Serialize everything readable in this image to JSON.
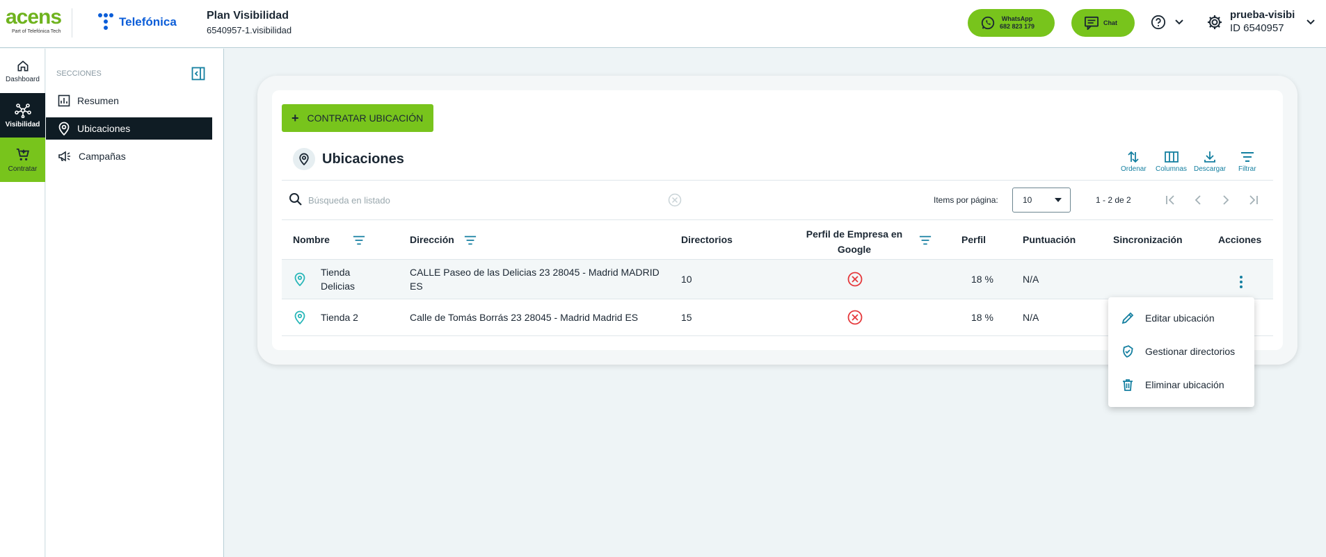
{
  "header": {
    "brand_acens": "acens",
    "brand_acens_sub": "Part of Telefónica Tech",
    "brand_telefonica": "Telefónica",
    "plan_title": "Plan Visibilidad",
    "plan_subtitle": "6540957-1.visibilidad",
    "whatsapp_label": "WhatsApp",
    "whatsapp_number": "682 823 179",
    "chat_label": "Chat",
    "user_name": "prueba-visibi",
    "user_id": "ID 6540957"
  },
  "leftnav": {
    "dashboard": "Dashboard",
    "visibilidad": "Visibilidad",
    "contratar": "Contratar"
  },
  "sidebar": {
    "heading": "SECCIONES",
    "items": [
      "Resumen",
      "Ubicaciones",
      "Campañas"
    ]
  },
  "main": {
    "add_button": "CONTRATAR UBICACIÓN",
    "title": "Ubicaciones",
    "tools": [
      "Ordenar",
      "Columnas",
      "Descargar",
      "Filtrar"
    ],
    "search_placeholder": "Búsqueda en listado",
    "items_per_page_label": "Items por página:",
    "items_per_page_value": "10",
    "range": "1 - 2 de 2"
  },
  "table": {
    "headers": {
      "nombre": "Nombre",
      "direccion": "Dirección",
      "directorios": "Directorios",
      "perfil_google_1": "Perfil de Empresa en",
      "perfil_google_2": "Google",
      "perfil": "Perfil",
      "puntuacion": "Puntuación",
      "sincronizacion": "Sincronización",
      "acciones": "Acciones"
    },
    "rows": [
      {
        "nombre_1": "Tienda",
        "nombre_2": "Delicias",
        "direccion_1": "CALLE Paseo de las Delicias 23 28045 - Madrid MADRID",
        "direccion_2": "ES",
        "directorios": "10",
        "perfil": "18 %",
        "puntuacion": "N/A"
      },
      {
        "nombre_1": "Tienda 2",
        "direccion_1": "Calle de Tomás Borrás 23 28045 - Madrid Madrid ES",
        "directorios": "15",
        "perfil": "18 %",
        "puntuacion": "N/A"
      }
    ]
  },
  "menu": {
    "items": [
      "Editar ubicación",
      "Gestionar directorios",
      "Eliminar ubicación"
    ]
  },
  "colors": {
    "accent_green": "#78c41c",
    "dark_nav": "#0f1c24",
    "teal": "#147fa0",
    "error_red": "#e5383b",
    "pin_teal": "#27b6b8"
  }
}
